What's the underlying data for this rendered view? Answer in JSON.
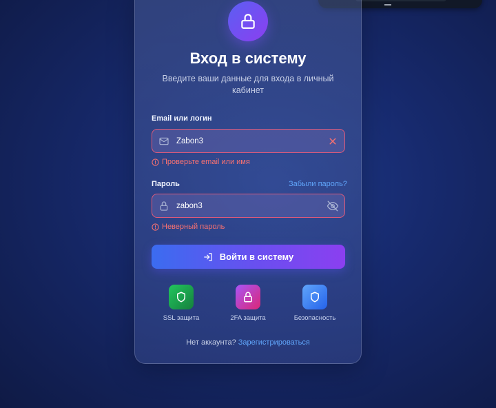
{
  "header": {
    "title": "Вход в систему",
    "subtitle": "Введите ваши данные для входа в личный кабинет"
  },
  "email": {
    "label": "Email или логин",
    "value": "Zabon3",
    "error": "Проверьте email или имя"
  },
  "password": {
    "label": "Пароль",
    "forgot_link": "Забыли пароль?",
    "value": "zabon3",
    "error": "Неверный пароль"
  },
  "submit": {
    "label": "Войти в систему"
  },
  "features": [
    {
      "label": "SSL защита",
      "icon": "shield-icon",
      "color": "#16a34a"
    },
    {
      "label": "2FA защита",
      "icon": "lock-icon",
      "color": "#c026d3"
    },
    {
      "label": "Безопасность",
      "icon": "shield-icon",
      "color": "#3b82f6"
    }
  ],
  "footer": {
    "text": "Нет аккаунта?",
    "link": "Зарегистрироваться"
  },
  "colors": {
    "accent": "#6a4ff0",
    "error": "#f87171",
    "link": "#60a5fa"
  }
}
